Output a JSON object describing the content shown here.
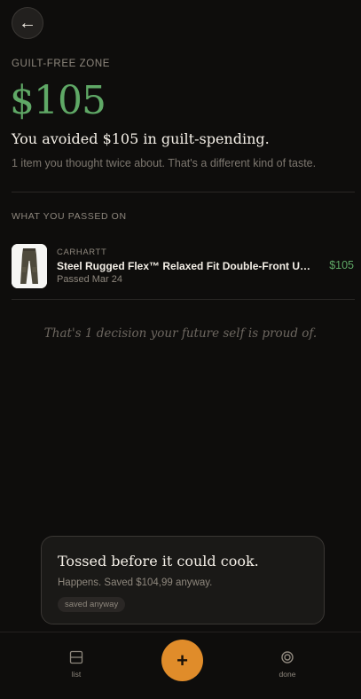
{
  "header": {
    "back_icon": "arrow-left-icon",
    "back_glyph": "←"
  },
  "summary": {
    "zone_label": "GUILT-FREE ZONE",
    "amount": "$105",
    "headline": "You avoided $105 in guilt-spending.",
    "subline": "1 item you thought twice about. That's a different kind of taste."
  },
  "passed": {
    "section_label": "WHAT YOU PASSED ON",
    "items": [
      {
        "brand": "CARHARTT",
        "title": "Steel Rugged Flex™ Relaxed Fit Double-Front Utility Work Pants",
        "date": "Passed Mar 24",
        "price": "$105"
      }
    ]
  },
  "quote": "That's 1 decision your future self is proud of.",
  "toast": {
    "title": "Tossed before it could cook.",
    "subtitle": "Happens. Saved $104,99 anyway.",
    "chip": "saved anyway"
  },
  "nav": {
    "list_label": "list",
    "done_label": "done",
    "add_glyph": "+"
  },
  "colors": {
    "background": "#0e0d0c",
    "accent_green": "#5fa866",
    "accent_orange": "#e08c2a"
  }
}
